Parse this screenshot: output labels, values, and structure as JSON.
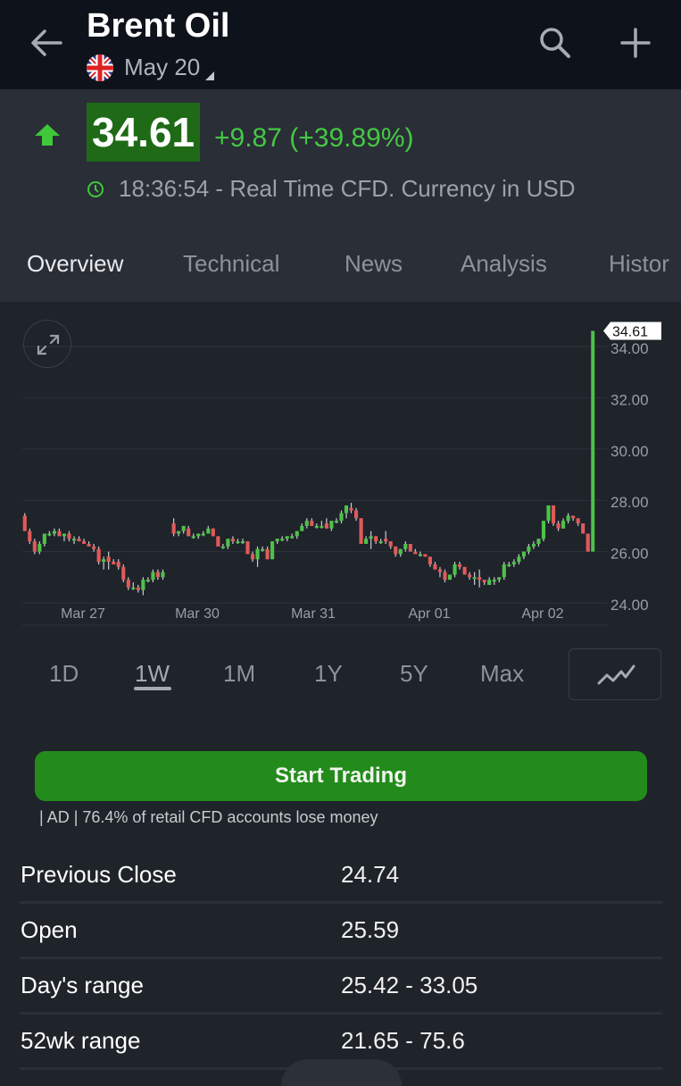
{
  "header": {
    "title": "Brent Oil",
    "contract": "May 20",
    "flag": "uk-flag-icon",
    "icons": {
      "back": "arrow-left-icon",
      "search": "search-icon",
      "add": "plus-icon"
    }
  },
  "quote": {
    "direction": "up",
    "last_price": "34.61",
    "change": "+9.87 (+39.89%)",
    "time_info": "18:36:54 - Real Time CFD. Currency in USD",
    "colors": {
      "up": "#44c844",
      "price_bg": "#1e6a16"
    }
  },
  "tabs": [
    {
      "label": "Overview",
      "active": true
    },
    {
      "label": "Technical",
      "active": false
    },
    {
      "label": "News",
      "active": false
    },
    {
      "label": "Analysis",
      "active": false
    },
    {
      "label": "Histor",
      "active": false
    }
  ],
  "ranges": [
    {
      "label": "1D",
      "active": false
    },
    {
      "label": "1W",
      "active": true
    },
    {
      "label": "1M",
      "active": false
    },
    {
      "label": "1Y",
      "active": false
    },
    {
      "label": "5Y",
      "active": false
    },
    {
      "label": "Max",
      "active": false
    }
  ],
  "cta": {
    "trade_label": "Start Trading",
    "disclaimer": "| AD | 76.4% of retail CFD accounts lose money"
  },
  "stats": [
    {
      "label": "Previous Close",
      "value": "24.74"
    },
    {
      "label": "Open",
      "value": "25.59"
    },
    {
      "label": "Day's range",
      "value": "25.42 - 33.05"
    },
    {
      "label": "52wk range",
      "value": "21.65 - 75.6"
    }
  ],
  "chart_data": {
    "type": "candlestick",
    "title": "",
    "xlabel": "",
    "ylabel": "",
    "ylim": [
      23.6,
      35.2
    ],
    "yticks": [
      "24.00",
      "26.00",
      "28.00",
      "30.00",
      "32.00",
      "34.00"
    ],
    "xticks": [
      "Mar 27",
      "Mar 30",
      "Mar 31",
      "Apr 01",
      "Apr 02"
    ],
    "grid": true,
    "last_price_label": "34.61",
    "colors": {
      "up": "#4ec24a",
      "down": "#e05a5a"
    },
    "candles": [
      {
        "o": 27.4,
        "h": 27.5,
        "l": 26.8,
        "c": 26.8
      },
      {
        "o": 26.8,
        "h": 26.9,
        "l": 26.3,
        "c": 26.4
      },
      {
        "o": 26.4,
        "h": 26.5,
        "l": 25.9,
        "c": 26.0
      },
      {
        "o": 26.0,
        "h": 26.4,
        "l": 25.9,
        "c": 26.3
      },
      {
        "o": 26.3,
        "h": 26.7,
        "l": 26.2,
        "c": 26.7
      },
      {
        "o": 26.7,
        "h": 26.8,
        "l": 26.6,
        "c": 26.7
      },
      {
        "o": 26.7,
        "h": 26.9,
        "l": 26.6,
        "c": 26.8
      },
      {
        "o": 26.8,
        "h": 26.9,
        "l": 26.6,
        "c": 26.6
      },
      {
        "o": 26.6,
        "h": 26.7,
        "l": 26.4,
        "c": 26.7
      },
      {
        "o": 26.7,
        "h": 26.8,
        "l": 26.4,
        "c": 26.5
      },
      {
        "o": 26.5,
        "h": 26.6,
        "l": 26.3,
        "c": 26.5
      },
      {
        "o": 26.5,
        "h": 26.6,
        "l": 26.4,
        "c": 26.4
      },
      {
        "o": 26.4,
        "h": 26.5,
        "l": 26.3,
        "c": 26.3
      },
      {
        "o": 26.3,
        "h": 26.4,
        "l": 26.2,
        "c": 26.2
      },
      {
        "o": 26.2,
        "h": 26.3,
        "l": 26.0,
        "c": 26.1
      },
      {
        "o": 26.1,
        "h": 26.2,
        "l": 25.5,
        "c": 25.6
      },
      {
        "o": 25.6,
        "h": 25.8,
        "l": 25.3,
        "c": 25.7
      },
      {
        "o": 25.8,
        "h": 26.0,
        "l": 25.3,
        "c": 25.6
      },
      {
        "o": 25.6,
        "h": 25.7,
        "l": 25.5,
        "c": 25.5
      },
      {
        "o": 25.6,
        "h": 25.7,
        "l": 25.3,
        "c": 25.4
      },
      {
        "o": 25.4,
        "h": 25.5,
        "l": 24.8,
        "c": 24.9
      },
      {
        "o": 24.9,
        "h": 25.0,
        "l": 24.5,
        "c": 24.6
      },
      {
        "o": 24.6,
        "h": 24.8,
        "l": 24.5,
        "c": 24.6
      },
      {
        "o": 24.6,
        "h": 24.7,
        "l": 24.4,
        "c": 24.5
      },
      {
        "o": 24.5,
        "h": 25.0,
        "l": 24.3,
        "c": 24.9
      },
      {
        "o": 24.9,
        "h": 25.0,
        "l": 24.8,
        "c": 24.9
      },
      {
        "o": 24.9,
        "h": 25.3,
        "l": 24.8,
        "c": 25.2
      },
      {
        "o": 25.2,
        "h": 25.3,
        "l": 24.9,
        "c": 25.0
      },
      {
        "o": 25.0,
        "h": 25.3,
        "l": 24.9,
        "c": 25.2
      },
      {
        "o": 27.1,
        "h": 27.3,
        "l": 26.6,
        "c": 26.7
      },
      {
        "o": 26.7,
        "h": 26.8,
        "l": 26.6,
        "c": 26.8
      },
      {
        "o": 26.8,
        "h": 27.0,
        "l": 26.7,
        "c": 27.0
      },
      {
        "o": 26.9,
        "h": 27.0,
        "l": 26.6,
        "c": 26.6
      },
      {
        "o": 26.6,
        "h": 26.7,
        "l": 26.5,
        "c": 26.6
      },
      {
        "o": 26.6,
        "h": 26.7,
        "l": 26.5,
        "c": 26.7
      },
      {
        "o": 26.7,
        "h": 26.8,
        "l": 26.6,
        "c": 26.7
      },
      {
        "o": 26.7,
        "h": 27.0,
        "l": 26.7,
        "c": 26.9
      },
      {
        "o": 26.9,
        "h": 26.9,
        "l": 26.6,
        "c": 26.6
      },
      {
        "o": 26.6,
        "h": 26.6,
        "l": 26.2,
        "c": 26.2
      },
      {
        "o": 26.2,
        "h": 26.3,
        "l": 26.1,
        "c": 26.2
      },
      {
        "o": 26.2,
        "h": 26.5,
        "l": 26.1,
        "c": 26.5
      },
      {
        "o": 26.5,
        "h": 26.6,
        "l": 26.3,
        "c": 26.4
      },
      {
        "o": 26.4,
        "h": 26.5,
        "l": 26.3,
        "c": 26.4
      },
      {
        "o": 26.4,
        "h": 26.5,
        "l": 26.3,
        "c": 26.4
      },
      {
        "o": 26.4,
        "h": 26.4,
        "l": 25.9,
        "c": 25.9
      },
      {
        "o": 25.9,
        "h": 26.0,
        "l": 25.6,
        "c": 25.7
      },
      {
        "o": 25.7,
        "h": 26.2,
        "l": 25.4,
        "c": 26.1
      },
      {
        "o": 26.1,
        "h": 26.2,
        "l": 26.0,
        "c": 26.1
      },
      {
        "o": 26.1,
        "h": 26.2,
        "l": 25.7,
        "c": 25.7
      },
      {
        "o": 25.7,
        "h": 26.4,
        "l": 25.7,
        "c": 26.4
      },
      {
        "o": 26.4,
        "h": 26.5,
        "l": 26.3,
        "c": 26.5
      },
      {
        "o": 26.5,
        "h": 26.6,
        "l": 26.4,
        "c": 26.5
      },
      {
        "o": 26.5,
        "h": 26.6,
        "l": 26.4,
        "c": 26.6
      },
      {
        "o": 26.6,
        "h": 26.7,
        "l": 26.5,
        "c": 26.6
      },
      {
        "o": 26.6,
        "h": 26.8,
        "l": 26.5,
        "c": 26.8
      },
      {
        "o": 26.8,
        "h": 27.1,
        "l": 26.8,
        "c": 27.0
      },
      {
        "o": 27.0,
        "h": 27.3,
        "l": 26.9,
        "c": 27.2
      },
      {
        "o": 27.2,
        "h": 27.3,
        "l": 27.0,
        "c": 27.0
      },
      {
        "o": 27.0,
        "h": 27.1,
        "l": 26.9,
        "c": 27.0
      },
      {
        "o": 27.0,
        "h": 27.2,
        "l": 26.9,
        "c": 27.0
      },
      {
        "o": 27.1,
        "h": 27.3,
        "l": 26.9,
        "c": 26.9
      },
      {
        "o": 26.9,
        "h": 27.2,
        "l": 26.8,
        "c": 27.2
      },
      {
        "o": 27.2,
        "h": 27.3,
        "l": 27.1,
        "c": 27.2
      },
      {
        "o": 27.2,
        "h": 27.6,
        "l": 27.1,
        "c": 27.5
      },
      {
        "o": 27.5,
        "h": 27.8,
        "l": 27.3,
        "c": 27.8
      },
      {
        "o": 27.7,
        "h": 27.9,
        "l": 27.5,
        "c": 27.6
      },
      {
        "o": 27.6,
        "h": 27.7,
        "l": 27.2,
        "c": 27.3
      },
      {
        "o": 27.3,
        "h": 27.3,
        "l": 26.3,
        "c": 26.3
      },
      {
        "o": 26.3,
        "h": 26.6,
        "l": 26.3,
        "c": 26.5
      },
      {
        "o": 26.5,
        "h": 26.8,
        "l": 26.1,
        "c": 26.6
      },
      {
        "o": 26.6,
        "h": 26.6,
        "l": 26.3,
        "c": 26.4
      },
      {
        "o": 26.4,
        "h": 26.5,
        "l": 26.3,
        "c": 26.4
      },
      {
        "o": 26.5,
        "h": 26.8,
        "l": 26.3,
        "c": 26.4
      },
      {
        "o": 26.4,
        "h": 26.4,
        "l": 26.1,
        "c": 26.2
      },
      {
        "o": 26.2,
        "h": 26.2,
        "l": 25.8,
        "c": 25.9
      },
      {
        "o": 25.9,
        "h": 26.1,
        "l": 25.8,
        "c": 26.1
      },
      {
        "o": 26.1,
        "h": 26.4,
        "l": 26.0,
        "c": 26.3
      },
      {
        "o": 26.3,
        "h": 26.3,
        "l": 26.0,
        "c": 26.0
      },
      {
        "o": 26.0,
        "h": 26.1,
        "l": 25.9,
        "c": 25.9
      },
      {
        "o": 25.9,
        "h": 26.0,
        "l": 25.8,
        "c": 25.9
      },
      {
        "o": 25.9,
        "h": 25.9,
        "l": 25.8,
        "c": 25.8
      },
      {
        "o": 25.8,
        "h": 25.8,
        "l": 25.4,
        "c": 25.5
      },
      {
        "o": 25.5,
        "h": 25.6,
        "l": 25.3,
        "c": 25.3
      },
      {
        "o": 25.3,
        "h": 25.4,
        "l": 25.0,
        "c": 25.2
      },
      {
        "o": 25.2,
        "h": 25.3,
        "l": 24.8,
        "c": 24.9
      },
      {
        "o": 24.9,
        "h": 25.1,
        "l": 24.9,
        "c": 25.1
      },
      {
        "o": 25.1,
        "h": 25.6,
        "l": 25.0,
        "c": 25.5
      },
      {
        "o": 25.5,
        "h": 25.6,
        "l": 25.3,
        "c": 25.4
      },
      {
        "o": 25.4,
        "h": 25.4,
        "l": 25.1,
        "c": 25.1
      },
      {
        "o": 25.1,
        "h": 25.2,
        "l": 24.9,
        "c": 25.0
      },
      {
        "o": 25.0,
        "h": 25.2,
        "l": 24.7,
        "c": 25.0
      },
      {
        "o": 25.0,
        "h": 25.3,
        "l": 24.6,
        "c": 24.9
      },
      {
        "o": 24.9,
        "h": 24.9,
        "l": 24.7,
        "c": 24.8
      },
      {
        "o": 24.7,
        "h": 25.0,
        "l": 24.7,
        "c": 24.9
      },
      {
        "o": 24.9,
        "h": 25.0,
        "l": 24.7,
        "c": 24.9
      },
      {
        "o": 24.9,
        "h": 25.0,
        "l": 24.8,
        "c": 25.0
      },
      {
        "o": 25.0,
        "h": 25.6,
        "l": 24.9,
        "c": 25.5
      },
      {
        "o": 25.5,
        "h": 25.6,
        "l": 25.4,
        "c": 25.5
      },
      {
        "o": 25.5,
        "h": 25.7,
        "l": 25.4,
        "c": 25.6
      },
      {
        "o": 25.6,
        "h": 25.9,
        "l": 25.5,
        "c": 25.8
      },
      {
        "o": 25.8,
        "h": 26.0,
        "l": 25.7,
        "c": 26.0
      },
      {
        "o": 26.0,
        "h": 26.3,
        "l": 25.9,
        "c": 26.2
      },
      {
        "o": 26.2,
        "h": 26.4,
        "l": 26.1,
        "c": 26.3
      },
      {
        "o": 26.3,
        "h": 26.5,
        "l": 26.2,
        "c": 26.5
      },
      {
        "o": 26.5,
        "h": 27.2,
        "l": 26.4,
        "c": 27.2
      },
      {
        "o": 27.2,
        "h": 27.8,
        "l": 27.1,
        "c": 27.8
      },
      {
        "o": 27.8,
        "h": 27.8,
        "l": 27.0,
        "c": 27.1
      },
      {
        "o": 27.1,
        "h": 27.2,
        "l": 26.8,
        "c": 26.9
      },
      {
        "o": 26.9,
        "h": 27.3,
        "l": 26.9,
        "c": 27.2
      },
      {
        "o": 27.2,
        "h": 27.5,
        "l": 27.1,
        "c": 27.4
      },
      {
        "o": 27.4,
        "h": 27.4,
        "l": 27.2,
        "c": 27.3
      },
      {
        "o": 27.3,
        "h": 27.3,
        "l": 27.0,
        "c": 27.1
      },
      {
        "o": 27.1,
        "h": 27.1,
        "l": 26.7,
        "c": 26.7
      },
      {
        "o": 26.7,
        "h": 26.7,
        "l": 26.0,
        "c": 26.0
      },
      {
        "o": 26.0,
        "h": 34.61,
        "l": 26.0,
        "c": 34.61
      }
    ],
    "gaps_after_index": [
      28
    ]
  }
}
